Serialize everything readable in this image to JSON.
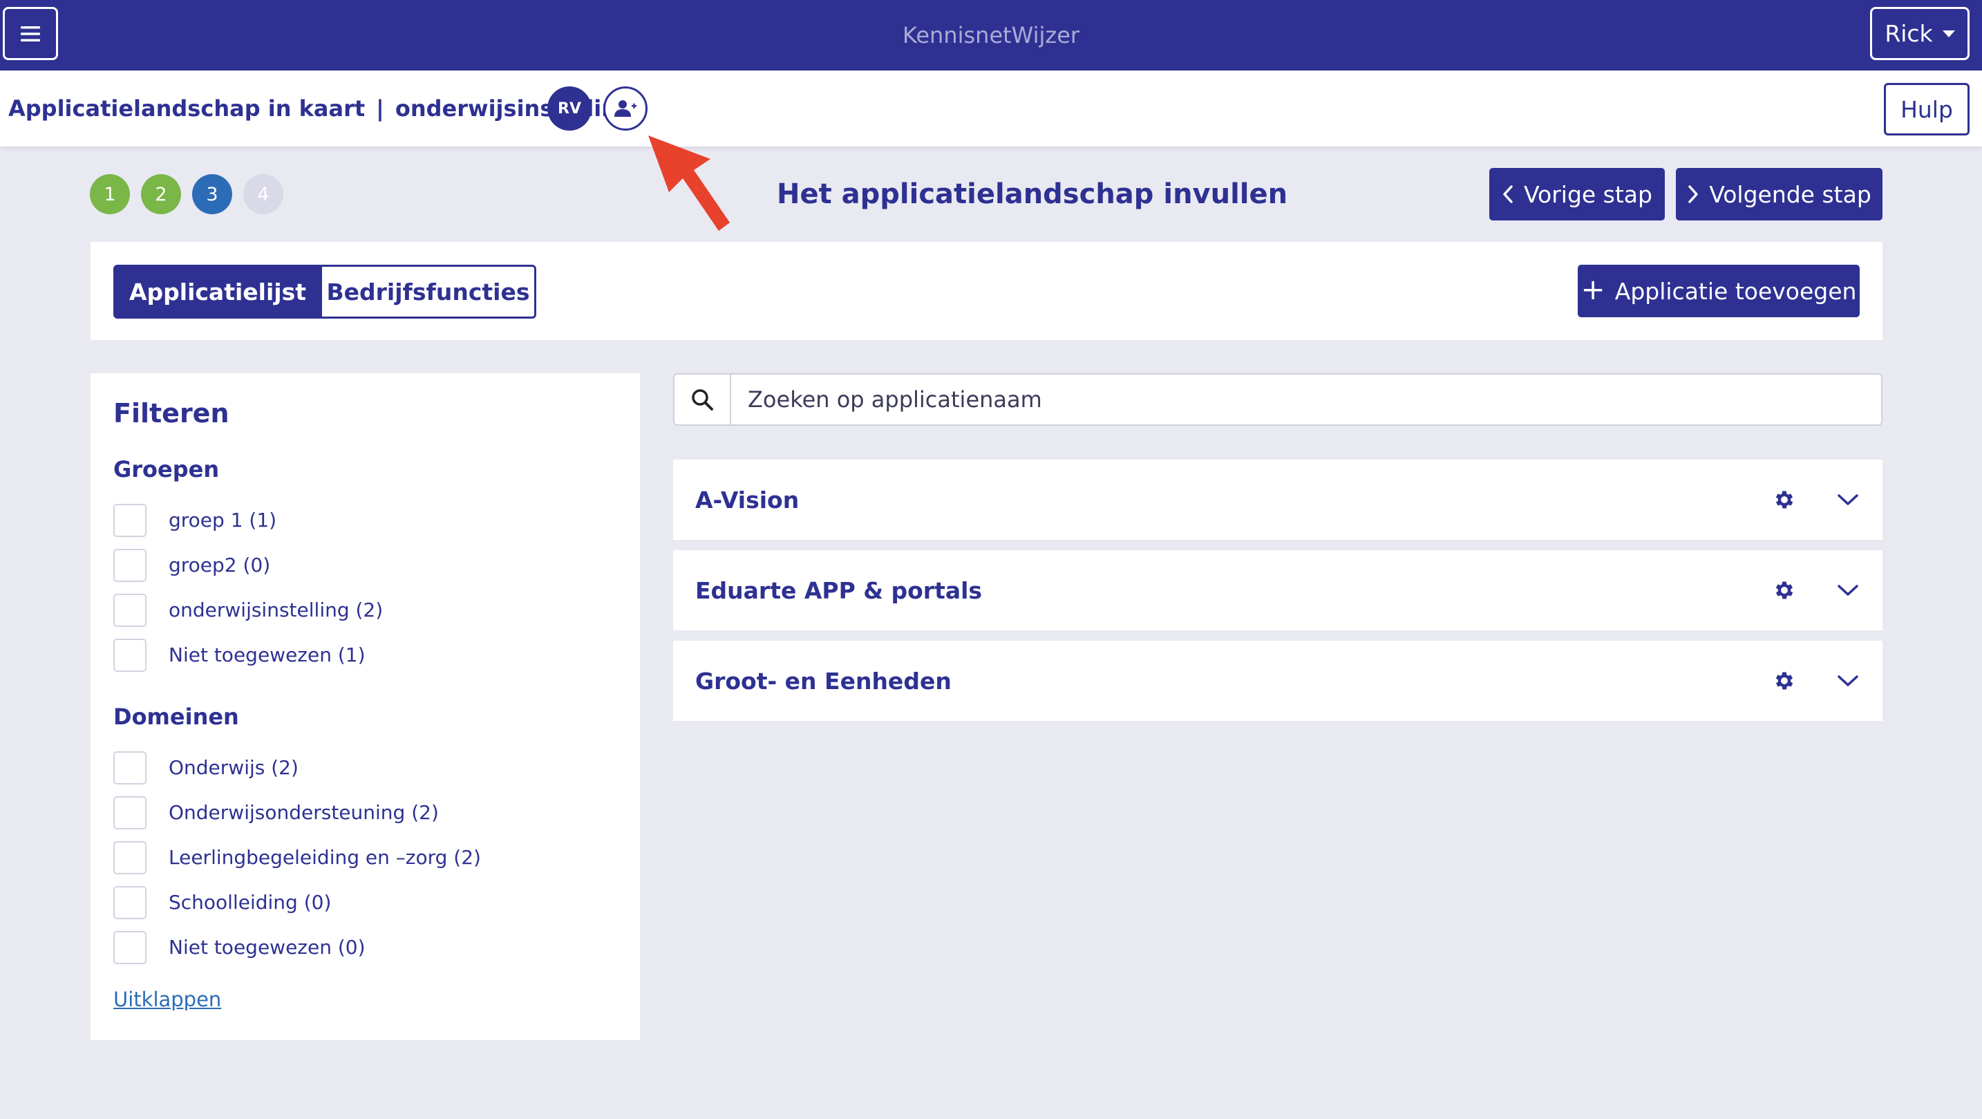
{
  "topbar": {
    "app_title": "KennisnetWijzer",
    "user_name": "Rick"
  },
  "subbar": {
    "breadcrumb_main": "Applicatielandschap in kaart",
    "breadcrumb_separator": "|",
    "breadcrumb_org": "onderwijsinstelling",
    "avatar_initials": "RV",
    "help_label": "Hulp"
  },
  "wizard": {
    "steps": [
      {
        "label": "1",
        "state": "done"
      },
      {
        "label": "2",
        "state": "done"
      },
      {
        "label": "3",
        "state": "active"
      },
      {
        "label": "4",
        "state": "todo"
      }
    ],
    "heading": "Het applicatielandschap invullen",
    "prev_label": "Vorige stap",
    "next_label": "Volgende stap"
  },
  "tabs": {
    "items": [
      "Applicatielijst",
      "Bedrijfsfuncties"
    ],
    "add_app_label": "Applicatie toevoegen"
  },
  "filters": {
    "title": "Filteren",
    "groups_title": "Groepen",
    "groups": [
      "groep 1 (1)",
      "groep2 (0)",
      "onderwijsinstelling (2)",
      "Niet toegewezen (1)"
    ],
    "domains_title": "Domeinen",
    "domains": [
      "Onderwijs (2)",
      "Onderwijsondersteuning (2)",
      "Leerlingbegeleiding en –zorg (2)",
      "Schoolleiding (0)",
      "Niet toegewezen (0)"
    ],
    "expand_label": "Uitklappen"
  },
  "search": {
    "placeholder": "Zoeken op applicatienaam"
  },
  "applications": [
    "A-Vision",
    "Eduarte APP & portals",
    "Groot- en Eenheden"
  ],
  "colors": {
    "brand": "#2e3192",
    "step_done": "#7ab648",
    "step_active": "#2c6cb7",
    "background": "#e9e9f2",
    "annotation_arrow": "#e8412c"
  }
}
